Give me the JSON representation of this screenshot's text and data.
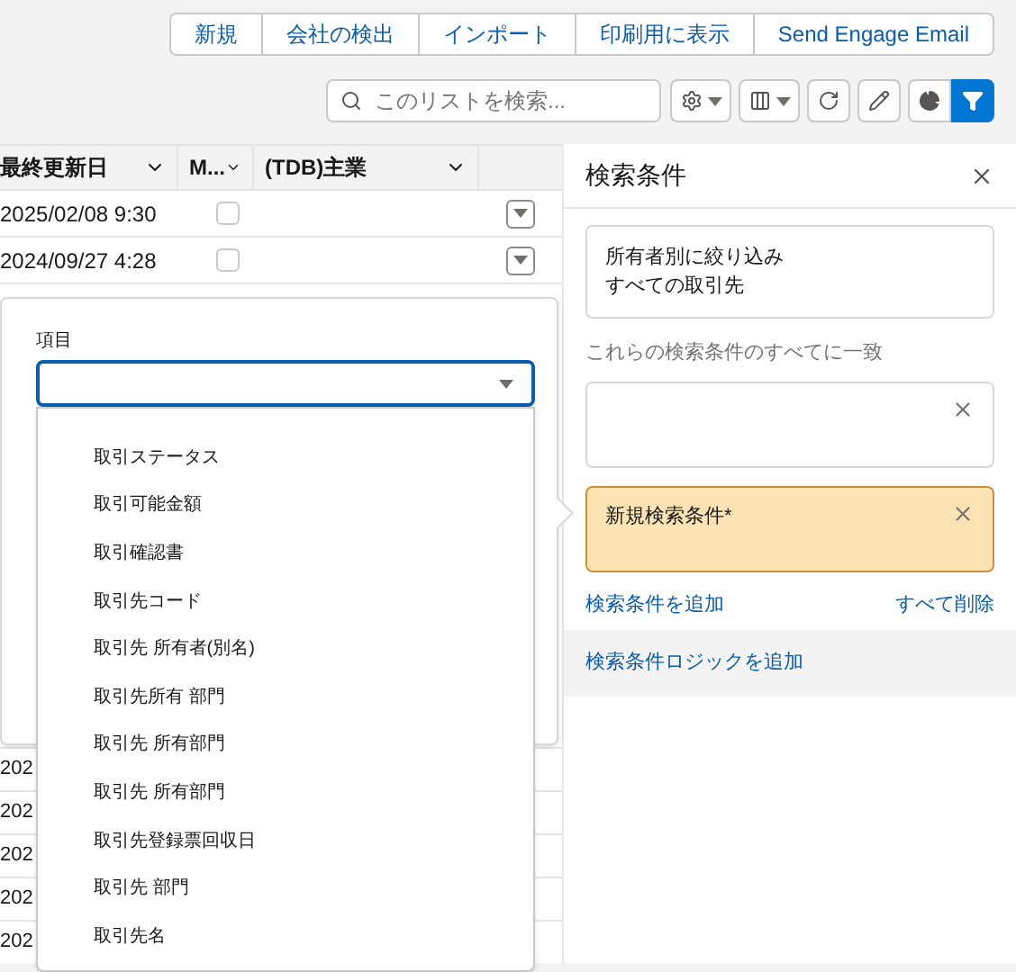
{
  "actions": [
    "新規",
    "会社の検出",
    "インポート",
    "印刷用に表示",
    "Send Engage Email"
  ],
  "search": {
    "placeholder": "このリストを検索..."
  },
  "toolbar": [
    {
      "kind": "gear",
      "selected": false
    },
    {
      "kind": "columns",
      "selected": false
    },
    {
      "kind": "refresh",
      "selected": false
    },
    {
      "kind": "edit",
      "selected": false
    },
    {
      "kind": "chart",
      "selected": false
    },
    {
      "kind": "filter",
      "selected": true
    }
  ],
  "table": {
    "columns": [
      "最終更新日",
      "M...",
      "(TDB)主業"
    ],
    "rows": [
      {
        "date": "2025/02/08 9:30",
        "checked": false
      },
      {
        "date": "2024/09/27 4:28",
        "checked": false
      }
    ],
    "rows_below": [
      "202",
      "202",
      "202",
      "202",
      "202"
    ]
  },
  "field_popover": {
    "label": "項目",
    "options": [
      "取引ステータス",
      "取引可能金額",
      "取引確認書",
      "取引先コード",
      "取引先 所有者(別名)",
      "取引先所有 部門",
      "取引先 所有部門",
      "取引先 所有部門",
      "取引先登録票回収日",
      "取引先 部門",
      "取引先名"
    ]
  },
  "filter_panel": {
    "title": "検索条件",
    "owner_filter": [
      "所有者別に絞り込み",
      "すべての取引先"
    ],
    "match_label": "これらの検索条件のすべてに一致",
    "filters": [
      {
        "kind": "existing"
      },
      {
        "label": "新規検索条件*",
        "kind": "new"
      }
    ],
    "add_link": "検索条件を追加",
    "remove_all": "すべて削除",
    "logic_link": "検索条件ロジックを追加"
  }
}
